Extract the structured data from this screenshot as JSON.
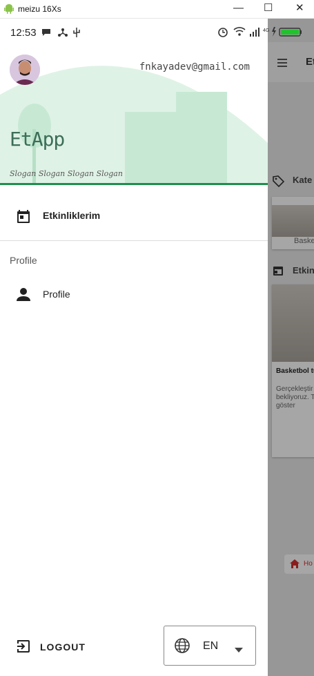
{
  "window": {
    "title": "meizu 16Xs"
  },
  "status_bar": {
    "time": "12:53",
    "network": "4G"
  },
  "drawer": {
    "email": "fnkayadev@gmail.com",
    "app_name": "EtApp",
    "slogan": "Slogan Slogan Slogan Slogan",
    "items": [
      {
        "label": "Etkinliklerim",
        "icon": "calendar-icon"
      },
      {
        "label": "Profile",
        "icon": "person-icon"
      }
    ],
    "section_label": "Profile",
    "logout_label": "LOGOUT",
    "language": {
      "selected": "EN"
    }
  },
  "background_app": {
    "title": "Et",
    "sections": [
      "Kate",
      "Etkin"
    ],
    "card_label": "Baske",
    "event_title": "Basketbol tu",
    "event_desc": [
      "Gerçekleştir",
      "bekliyoruz. T",
      "göster"
    ],
    "bottom_item": "Ho"
  },
  "colors": {
    "accent_green": "#1e8f4c",
    "header_bg": "#dff2e6",
    "scrim": "#000000"
  }
}
